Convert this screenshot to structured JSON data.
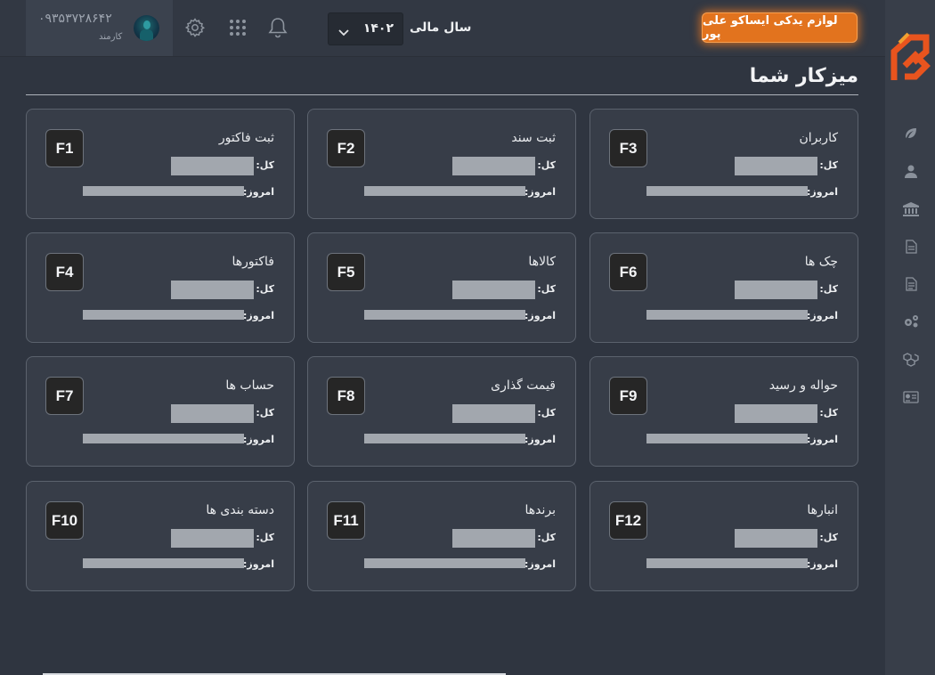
{
  "header": {
    "user_phone": "۰۹۳۵۳۷۲۸۶۴۲",
    "user_role": "کارمند",
    "fiscal_year_label": "سال مالی",
    "fiscal_year_value": "۱۴۰۲",
    "company_button": "لوازم یدکی ایساکو علی پور",
    "icons": [
      "settings-icon",
      "apps-grid-icon",
      "bell-icon",
      "chevron-down-icon"
    ]
  },
  "page": {
    "title": "میزکار شما"
  },
  "cards": [
    {
      "title": "ثبت فاکتور",
      "key": "F1",
      "total_label": "کل:",
      "today_label": "امروز:"
    },
    {
      "title": "ثبت سند",
      "key": "F2",
      "total_label": "کل:",
      "today_label": "امروز:"
    },
    {
      "title": "کاربران",
      "key": "F3",
      "total_label": "کل:",
      "today_label": "امروز:"
    },
    {
      "title": "فاکتورها",
      "key": "F4",
      "total_label": "کل:",
      "today_label": "امروز:"
    },
    {
      "title": "کالاها",
      "key": "F5",
      "total_label": "کل:",
      "today_label": "امروز:"
    },
    {
      "title": "چک ها",
      "key": "F6",
      "total_label": "کل:",
      "today_label": "امروز:"
    },
    {
      "title": "حساب ها",
      "key": "F7",
      "total_label": "کل:",
      "today_label": "امروز:"
    },
    {
      "title": "قیمت گذاری",
      "key": "F8",
      "total_label": "کل:",
      "today_label": "امروز:"
    },
    {
      "title": "حواله و رسید",
      "key": "F9",
      "total_label": "کل:",
      "today_label": "امروز:"
    },
    {
      "title": "دسته بندی ها",
      "key": "F10",
      "total_label": "کل:",
      "today_label": "امروز:"
    },
    {
      "title": "برندها",
      "key": "F11",
      "total_label": "کل:",
      "today_label": "امروز:"
    },
    {
      "title": "انبارها",
      "key": "F12",
      "total_label": "کل:",
      "today_label": "امروز:"
    }
  ],
  "sidebar": {
    "icons": [
      "leaf-icon",
      "user-icon",
      "bank-icon",
      "document-icon",
      "report-icon",
      "gears-icon",
      "boxes-icon",
      "id-card-icon"
    ]
  },
  "colors": {
    "background": "#2f3540",
    "card": "#373d48",
    "accent": "#e2731e",
    "placeholder_bar": "#a2a7ae"
  }
}
